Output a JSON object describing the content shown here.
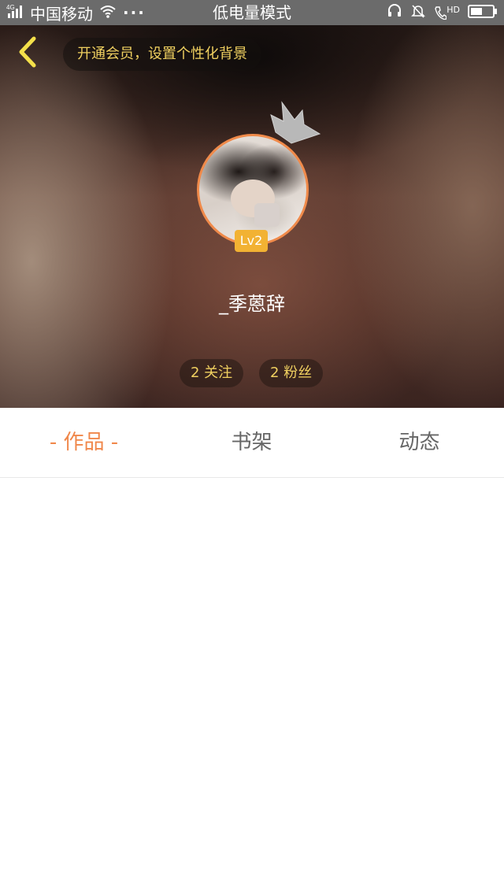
{
  "status_bar": {
    "network": "4G",
    "carrier": "中国移动",
    "more": "···",
    "mode": "低电量模式",
    "hd": "HD"
  },
  "header": {
    "vip_banner": "开通会员，设置个性化背景"
  },
  "profile": {
    "username": "_季蒽辞",
    "level": "Lv2",
    "following_label": "2 关注",
    "followers_label": "2 粉丝"
  },
  "tabs": [
    {
      "label": "- 作品 -",
      "active": true
    },
    {
      "label": "书架",
      "active": false
    },
    {
      "label": "动态",
      "active": false
    }
  ],
  "colors": {
    "accent": "#f0874a",
    "gold": "#f0d060",
    "badge": "#f2b233"
  }
}
